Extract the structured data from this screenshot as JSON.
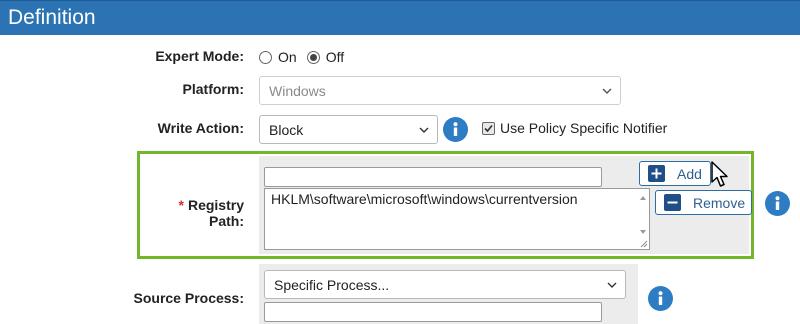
{
  "header": {
    "title": "Definition"
  },
  "expert_mode": {
    "label": "Expert Mode:",
    "options": [
      {
        "label": "On",
        "selected": false
      },
      {
        "label": "Off",
        "selected": true
      }
    ]
  },
  "platform": {
    "label": "Platform:",
    "value": "Windows",
    "disabled": true
  },
  "write_action": {
    "label": "Write Action:",
    "value": "Block",
    "notifier_label": "Use Policy Specific Notifier",
    "notifier_checked": true
  },
  "registry_path": {
    "required_marker": "*",
    "label": "Registry Path:",
    "input_value": "",
    "list_text": "HKLM\\software\\microsoft\\windows\\currentversion",
    "add_label": "Add",
    "remove_label": "Remove"
  },
  "source_process": {
    "label": "Source Process:",
    "value": "Specific Process...",
    "input_value": ""
  },
  "icons": {
    "info": "info-icon",
    "add": "plus-icon",
    "remove": "minus-icon",
    "cursor": "mouse-pointer-icon"
  },
  "colors": {
    "header": "#2c73b3",
    "highlight_border": "#73b52b",
    "info": "#2e7cc4",
    "button_border": "#2e6da4",
    "required": "#d42f2f"
  }
}
